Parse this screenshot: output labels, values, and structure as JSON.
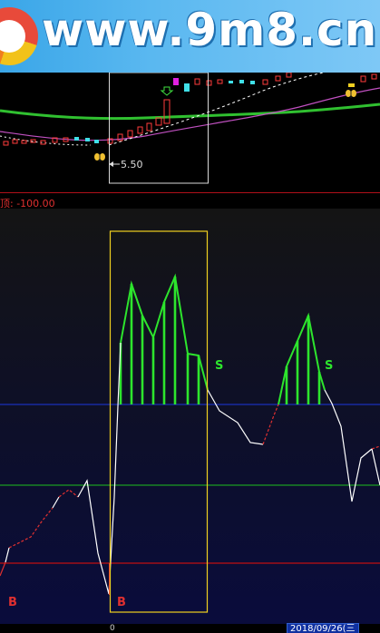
{
  "banner": {
    "watermark": "www.9m8.cn"
  },
  "upper_chart": {
    "annotation": "5.50"
  },
  "indicator": {
    "label": "顶: -100.00"
  },
  "signals": {
    "buy_left": "B",
    "buy_center": "B",
    "sell_1": "S",
    "sell_2": "S"
  },
  "footer": {
    "date": "2018/09/26(三",
    "zero_label": "0"
  },
  "colors": {
    "up_candle": "#ff3b3b",
    "down_candle": "#40e0e8",
    "ma_green": "#30c030",
    "ma_magenta": "#c050c0",
    "signal_bar": "#2de52d",
    "highlight_box": "#f0d020",
    "ref_blue": "#1a2fb8",
    "ref_green": "#1ec01e",
    "ref_red": "#c01010"
  }
}
